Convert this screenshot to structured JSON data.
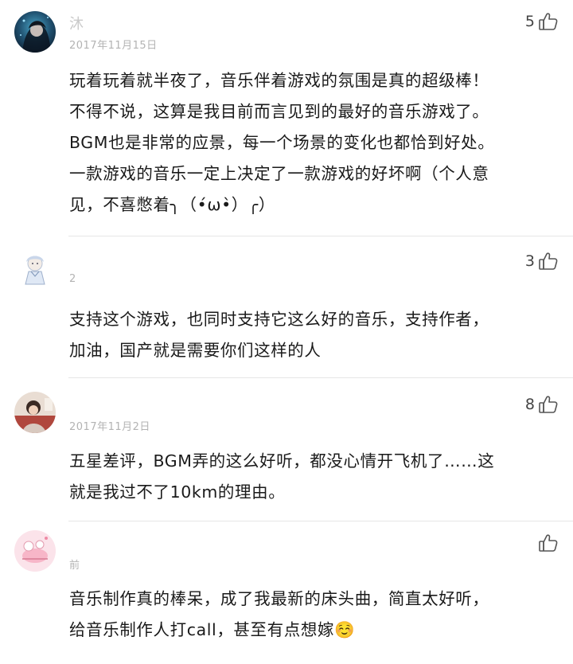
{
  "comments": [
    {
      "username": "沐",
      "timestamp": "2017年11月15日",
      "likes": "5",
      "lines": [
        "玩着玩着就半夜了，音乐伴着游戏的氛围是真的超级棒！",
        "不得不说，这算是我目前而言见到的最好的音乐游戏了。",
        "BGM也是非常的应景，每一个场景的变化也都恰到好处。",
        "一款游戏的音乐一定上决定了一款游戏的好坏啊（个人意",
        "见，不喜憋着╮（•́ω•̀）╭）"
      ]
    },
    {
      "username": "",
      "timestamp": "2",
      "likes": "3",
      "lines": [
        "支持这个游戏，也同时支持它这么好的音乐，支持作者，",
        "加油，国产就是需要你们这样的人"
      ]
    },
    {
      "username": "",
      "timestamp": "2017年11月2日",
      "likes": "8",
      "lines": [
        "五星差评，BGM弄的这么好听，都没心情开飞机了……这",
        "就是我过不了10km的理由。"
      ]
    },
    {
      "username": "",
      "timestamp": "前",
      "likes": "",
      "lines": [
        "音乐制作真的棒呆，成了我最新的床头曲，简直太好听，",
        "给音乐制作人打call，甚至有点想嫁☺️"
      ]
    }
  ],
  "icons": {
    "like": "thumbs-up-icon"
  },
  "colors": {
    "text": "#1a1a1a",
    "meta": "#b3b3b3",
    "divider": "#e6e6e6"
  }
}
